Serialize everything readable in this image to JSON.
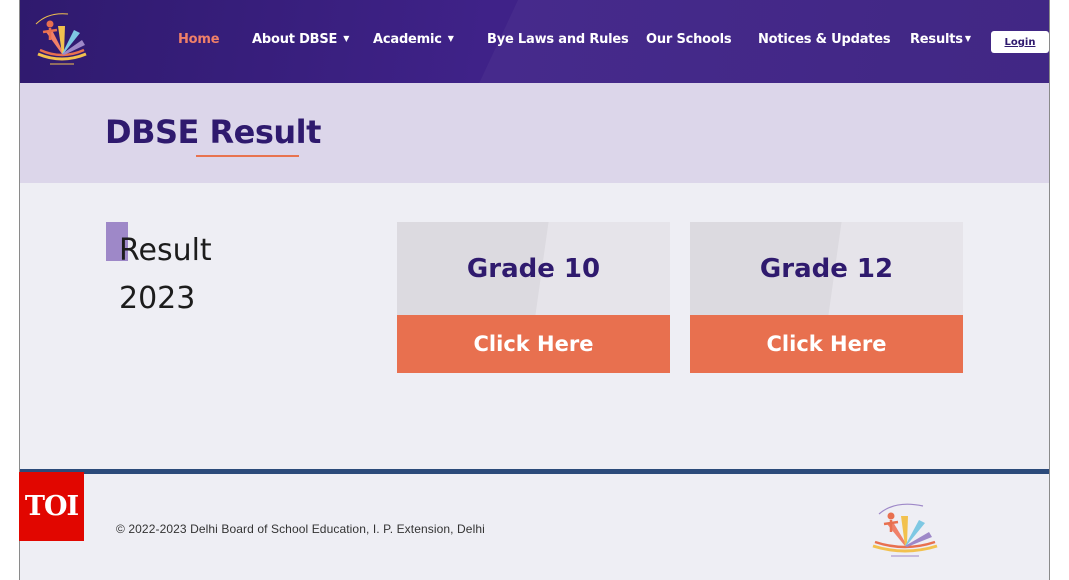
{
  "header": {
    "logo_icon": "dbse-logo-icon",
    "nav": [
      {
        "label": "Home",
        "active": true
      },
      {
        "label": "About DBSE",
        "dropdown": true
      },
      {
        "label": "Academic",
        "dropdown": true
      },
      {
        "label": "Bye Laws and Rules"
      },
      {
        "label": "Our Schools"
      },
      {
        "label": "Notices & Updates"
      },
      {
        "label": "Results",
        "dropdown": true
      }
    ],
    "login_label": "Login"
  },
  "title_band": {
    "title": "DBSE Result"
  },
  "main": {
    "result_line1": "Result",
    "result_line2": "2023",
    "cards": [
      {
        "grade": "Grade 10",
        "button": "Click Here"
      },
      {
        "grade": "Grade 12",
        "button": "Click Here"
      }
    ]
  },
  "footer": {
    "copyright": "© 2022-2023 Delhi Board of School Education, I. P. Extension, Delhi",
    "logo_icon": "dbse-logo-icon"
  },
  "watermark": "TOI",
  "colors": {
    "header_bg": "#3a1f80",
    "active_nav": "#f08068",
    "title_band_bg": "#dcd6ea",
    "title_text": "#2f1a6e",
    "accent_orange": "#e8704f",
    "accent_purple": "#9e88c8",
    "footer_line": "#2b4a7a",
    "toi_red": "#e10600"
  }
}
